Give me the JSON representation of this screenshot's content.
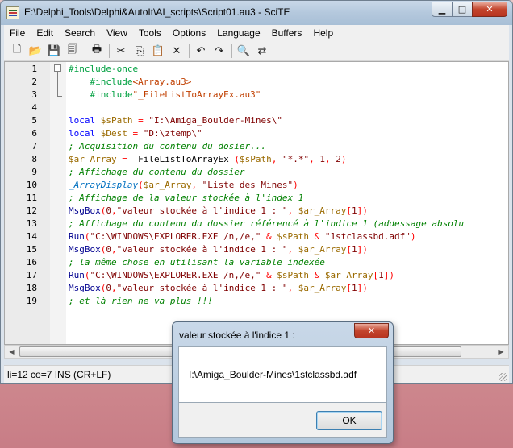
{
  "window": {
    "title": "E:\\Delphi_Tools\\Delphi&AutoIt\\AI_scripts\\Script01.au3 - SciTE",
    "controls": {
      "minimize": "▁",
      "maximize": "□",
      "close": "✕"
    }
  },
  "menu": [
    "File",
    "Edit",
    "Search",
    "View",
    "Tools",
    "Options",
    "Language",
    "Buffers",
    "Help"
  ],
  "toolbar": [
    {
      "name": "new-file-icon",
      "glyph": "🗋"
    },
    {
      "name": "open-folder-icon",
      "glyph": "📂"
    },
    {
      "name": "save-icon",
      "glyph": "💾"
    },
    {
      "name": "close-file-icon",
      "glyph": "🗐"
    },
    {
      "sep": true
    },
    {
      "name": "print-icon",
      "glyph": "🖶"
    },
    {
      "sep": true
    },
    {
      "name": "cut-icon",
      "glyph": "✂"
    },
    {
      "name": "copy-icon",
      "glyph": "⎘"
    },
    {
      "name": "paste-icon",
      "glyph": "📋"
    },
    {
      "name": "delete-icon",
      "glyph": "✕"
    },
    {
      "sep": true
    },
    {
      "name": "undo-icon",
      "glyph": "↶"
    },
    {
      "name": "redo-icon",
      "glyph": "↷"
    },
    {
      "sep": true
    },
    {
      "name": "find-icon",
      "glyph": "🔍"
    },
    {
      "name": "find-replace-icon",
      "glyph": "⇄"
    }
  ],
  "code_lines": [
    [
      [
        "dir",
        "#include-once"
      ]
    ],
    [
      [
        "def",
        "    "
      ],
      [
        "dir",
        "#include"
      ],
      [
        "inc",
        "<Array.au3>"
      ]
    ],
    [
      [
        "def",
        "    "
      ],
      [
        "dir",
        "#include"
      ],
      [
        "inc",
        "\"_FileListToArrayEx.au3\""
      ]
    ],
    [],
    [
      [
        "kw",
        "local "
      ],
      [
        "var",
        "$sPath"
      ],
      [
        "op",
        " = "
      ],
      [
        "str",
        "\"I:\\Amiga_Boulder-Mines\\\""
      ]
    ],
    [
      [
        "kw",
        "local "
      ],
      [
        "var",
        "$Dest"
      ],
      [
        "op",
        " = "
      ],
      [
        "str",
        "\"D:\\ztemp\\\""
      ]
    ],
    [
      [
        "com",
        "; Acquisition du contenu du dosier..."
      ]
    ],
    [
      [
        "var",
        "$ar_Array"
      ],
      [
        "op",
        " = "
      ],
      [
        "def",
        "_FileListToArrayEx "
      ],
      [
        "op",
        "("
      ],
      [
        "var",
        "$sPath"
      ],
      [
        "op",
        ", "
      ],
      [
        "str",
        "\"*.*\""
      ],
      [
        "op",
        ", "
      ],
      [
        "num",
        "1"
      ],
      [
        "op",
        ", "
      ],
      [
        "num",
        "2"
      ],
      [
        "op",
        ")"
      ]
    ],
    [
      [
        "com",
        "; Affichage du contenu du dossier"
      ]
    ],
    [
      [
        "udf-i",
        "_ArrayDisplay"
      ],
      [
        "op",
        "("
      ],
      [
        "var",
        "$ar_Array"
      ],
      [
        "op",
        ", "
      ],
      [
        "str",
        "\"Liste des Mines\""
      ],
      [
        "op",
        ")"
      ]
    ],
    [
      [
        "com",
        "; Affichage de la valeur stockée à l'index 1"
      ]
    ],
    [
      [
        "fn",
        "MsgBox"
      ],
      [
        "op",
        "("
      ],
      [
        "num",
        "0"
      ],
      [
        "op",
        ","
      ],
      [
        "str",
        "\"valeur stockée à l'indice 1 : \""
      ],
      [
        "op",
        ", "
      ],
      [
        "var",
        "$ar_Array"
      ],
      [
        "op",
        "["
      ],
      [
        "num",
        "1"
      ],
      [
        "op",
        "])"
      ]
    ],
    [
      [
        "com",
        "; Affichage du contenu du dossier référencé à l'indice 1 (addessage absolu"
      ]
    ],
    [
      [
        "fn",
        "Run"
      ],
      [
        "op",
        "("
      ],
      [
        "str",
        "\"C:\\WINDOWS\\EXPLORER.EXE /n,/e,\""
      ],
      [
        "op",
        " & "
      ],
      [
        "var",
        "$sPath"
      ],
      [
        "op",
        " & "
      ],
      [
        "str",
        "\"1stclassbd.adf\""
      ],
      [
        "op",
        ")"
      ]
    ],
    [
      [
        "fn",
        "MsgBox"
      ],
      [
        "op",
        "("
      ],
      [
        "num",
        "0"
      ],
      [
        "op",
        ","
      ],
      [
        "str",
        "\"valeur stockée à l'indice 1 : \""
      ],
      [
        "op",
        ", "
      ],
      [
        "var",
        "$ar_Array"
      ],
      [
        "op",
        "["
      ],
      [
        "num",
        "1"
      ],
      [
        "op",
        "])"
      ]
    ],
    [
      [
        "com",
        "; la même chose en utilisant la variable indexée"
      ]
    ],
    [
      [
        "fn",
        "Run"
      ],
      [
        "op",
        "("
      ],
      [
        "str",
        "\"C:\\WINDOWS\\EXPLORER.EXE /n,/e,\""
      ],
      [
        "op",
        " & "
      ],
      [
        "var",
        "$sPath"
      ],
      [
        "op",
        " & "
      ],
      [
        "var",
        "$ar_Array"
      ],
      [
        "op",
        "["
      ],
      [
        "num",
        "1"
      ],
      [
        "op",
        "])"
      ]
    ],
    [
      [
        "fn",
        "MsgBox"
      ],
      [
        "op",
        "("
      ],
      [
        "num",
        "0"
      ],
      [
        "op",
        ","
      ],
      [
        "str",
        "\"valeur stockée à l'indice 1 : \""
      ],
      [
        "op",
        ", "
      ],
      [
        "var",
        "$ar_Array"
      ],
      [
        "op",
        "["
      ],
      [
        "num",
        "1"
      ],
      [
        "op",
        "])"
      ]
    ],
    [
      [
        "com",
        "; et là rien ne va plus !!!"
      ]
    ]
  ],
  "statusbar": {
    "text": "li=12 co=7 INS (CR+LF)"
  },
  "dialog": {
    "title": "valeur stockée à l'indice 1 :",
    "close_glyph": "✕",
    "message": "I:\\Amiga_Boulder-Mines\\1stclassbd.adf",
    "ok_label": "OK"
  },
  "scroll": {
    "left_glyph": "◀",
    "right_glyph": "▶"
  }
}
